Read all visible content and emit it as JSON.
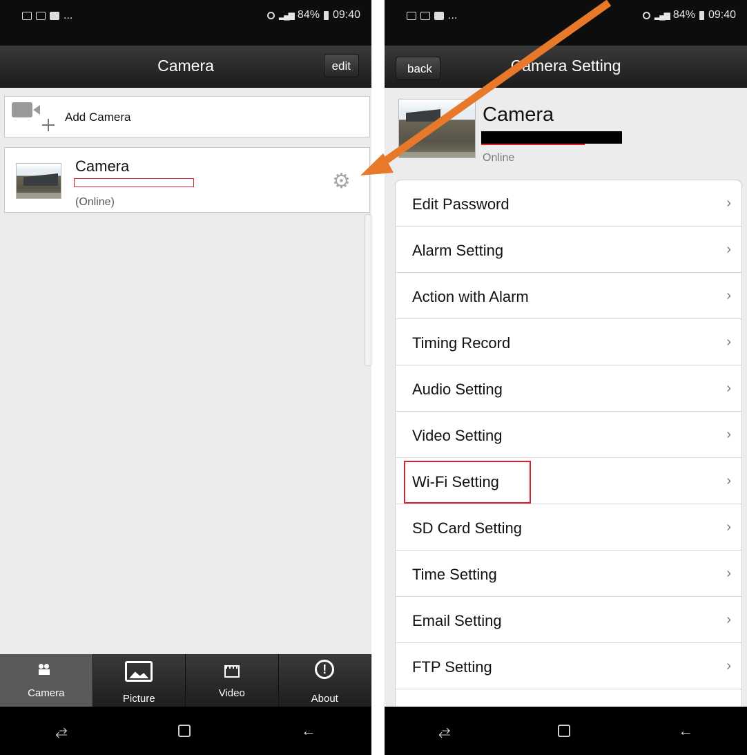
{
  "left": {
    "status": {
      "time": "09:40",
      "battery": "84%",
      "left_icons": "..."
    },
    "nav": {
      "title": "Camera",
      "edit_label": "edit"
    },
    "add_camera": {
      "label": "Add Camera"
    },
    "camera_item": {
      "name": "Camera",
      "status": "(Online)"
    },
    "tabs": [
      {
        "label": "Camera",
        "icon": "camera-tab-icon"
      },
      {
        "label": "Picture",
        "icon": "picture-icon"
      },
      {
        "label": "Video",
        "icon": "video-icon"
      },
      {
        "label": "About",
        "icon": "info-icon"
      }
    ]
  },
  "right": {
    "status": {
      "time": "09:40",
      "battery": "84%",
      "left_icons": "..."
    },
    "nav": {
      "title": "Camera Setting",
      "back_label": "back"
    },
    "header": {
      "name": "Camera",
      "status": "Online"
    },
    "settings": [
      "Edit Password",
      "Alarm Setting",
      "Action with Alarm",
      "Timing Record",
      "Audio Setting",
      "Video Setting",
      "Wi-Fi Setting",
      "SD Card Setting",
      "Time Setting",
      "Email Setting",
      "FTP Setting"
    ]
  },
  "annotation": {
    "arrow_color": "#e8792b",
    "highlight_color": "#d8202c"
  }
}
